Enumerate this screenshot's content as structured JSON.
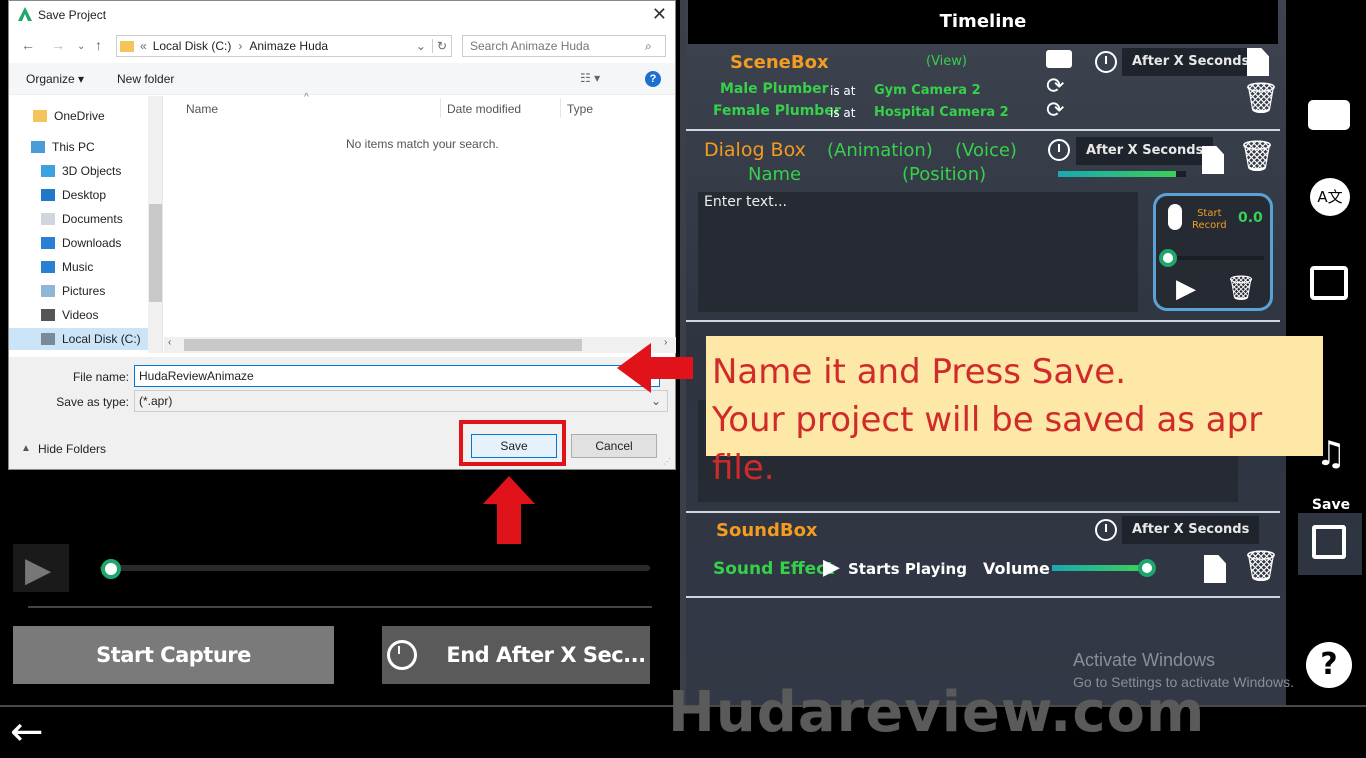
{
  "dialog": {
    "title": "Save Project",
    "address": {
      "prefix": "«",
      "crumb1": "Local Disk (C:)",
      "sep": "›",
      "crumb2": "Animaze Huda"
    },
    "search_placeholder": "Search Animaze Huda",
    "organize": "Organize ▾",
    "new_folder": "New folder",
    "nav_items": [
      "OneDrive",
      "This PC",
      "3D Objects",
      "Desktop",
      "Documents",
      "Downloads",
      "Music",
      "Pictures",
      "Videos",
      "Local Disk (C:)"
    ],
    "columns": [
      "Name",
      "Date modified",
      "Type"
    ],
    "empty_msg": "No items match your search.",
    "file_name_label": "File name:",
    "file_name_value": "HudaReviewAnimaze",
    "save_type_label": "Save as type:",
    "save_type_value": "(*.apr)",
    "hide_folders": "Hide Folders",
    "save_btn": "Save",
    "cancel_btn": "Cancel"
  },
  "capture": {
    "start": "Start Capture",
    "end": "End After X Sec..."
  },
  "timeline": {
    "header": "Timeline",
    "scenebox": {
      "title": "SceneBox",
      "view": "(View)",
      "row1_name": "Male Plumber",
      "row1_at": "is at",
      "row1_place": "Gym Camera 2",
      "row2_name": "Female Plumber",
      "row2_at": "is at",
      "row2_place": "Hospital Camera 2",
      "timer": "After X Seconds"
    },
    "dialogbox": {
      "title": "Dialog Box",
      "animation": "(Animation)",
      "voice": "(Voice)",
      "name": "Name",
      "position": "(Position)",
      "timer": "After X Seconds",
      "text_placeholder": "Enter text...",
      "start_record_1": "Start",
      "start_record_2": "Record",
      "record_time": "0.0",
      "volume_level": 0.92
    },
    "soundbox": {
      "title": "SoundBox",
      "timer": "After X Seconds",
      "effect": "Sound Effect",
      "starts": "Starts Playing",
      "volume": "Volume",
      "volume_level": 0.9
    }
  },
  "sidebar": {
    "save_label": "Save"
  },
  "callout": {
    "line1": "Name it and Press Save.",
    "line2": "Your project will be saved as apr file."
  },
  "activate": {
    "line1": "Activate Windows",
    "line2": "Go to Settings to activate Windows."
  },
  "watermark": "Hudareview.com",
  "colors": {
    "accent_red": "#e0131a",
    "orange": "#f39c1f",
    "green": "#36d04a",
    "callout_bg": "#fde8a8"
  }
}
